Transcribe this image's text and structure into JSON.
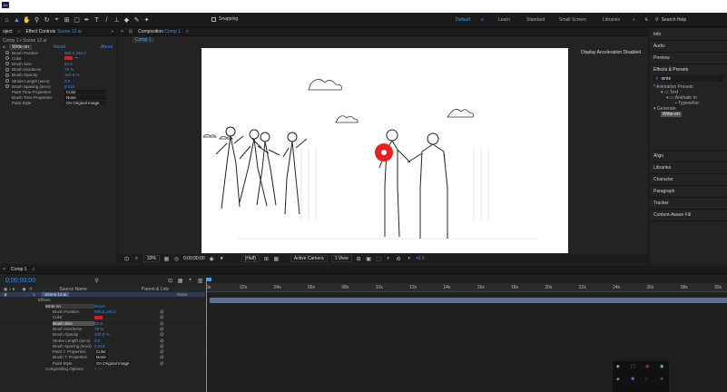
{
  "app": {
    "logo": "Ae"
  },
  "toolbar": {
    "snapping": "Snapping",
    "workspaces": [
      "Default",
      "Learn",
      "Standard",
      "Small Screen",
      "Libraries"
    ],
    "search_placeholder": "Search Help"
  },
  "project_panel": {
    "tab": "oject"
  },
  "effect_controls": {
    "tab": "Effect Controls",
    "layer": "Scene 12.ai",
    "breadcrumb": "Comp 1 • Scene 12.ai",
    "effect": "Write-on",
    "reset": "Reset",
    "about": "About",
    "props": [
      {
        "name": "Brush Position",
        "value": "985.0,340.0"
      },
      {
        "name": "Color",
        "value": ""
      },
      {
        "name": "Brush Size",
        "value": "62.5"
      },
      {
        "name": "Brush Hardness",
        "value": "79 %"
      },
      {
        "name": "Brush Opacity",
        "value": "100.0 %"
      },
      {
        "name": "Stroke Length (secs)",
        "value": "0.0"
      },
      {
        "name": "Brush Spacing (secs)",
        "value": "0.010"
      },
      {
        "name": "Paint Time Properties",
        "value": "Color"
      },
      {
        "name": "Brush Time Properties",
        "value": "None"
      },
      {
        "name": "Paint Style",
        "value": "On Original Image"
      }
    ],
    "red": "#e01b1b"
  },
  "composition": {
    "tab": "Composition",
    "comp": "Comp 1",
    "subtab": "Comp 1",
    "gpu_msg": "Display Acceleration Disabled",
    "bottom": {
      "zoom": "33%",
      "timecode": "0;00;00;00",
      "res": "(Half)",
      "camera": "Active Camera",
      "view": "1 View",
      "offset": "+0.0"
    }
  },
  "right_panel": {
    "items_top": [
      "Info",
      "Audio",
      "Preview"
    ],
    "effects_title": "Effects & Presets",
    "effects_search": "write",
    "tree": [
      "* Animation Presets",
      "Text",
      "Animate In",
      "Typewriter",
      "Generate",
      "Write-on"
    ],
    "items_bottom": [
      "Align",
      "Libraries",
      "Character",
      "Paragraph",
      "Tracker",
      "Content-Aware Fill"
    ]
  },
  "timeline": {
    "tab": "Comp 1",
    "timecode": "0;00;00;00",
    "col_source": "Source Name",
    "col_parent": "Parent & Link",
    "layer": {
      "num": "1",
      "name": "Scene 12.ai",
      "parent": "None"
    },
    "rows": [
      {
        "name": "Effects",
        "value": "",
        "indent": 1
      },
      {
        "name": "Write-on",
        "value": "Reset",
        "indent": 2
      },
      {
        "name": "Brush Position",
        "value": "985.0,340.0",
        "indent": 3
      },
      {
        "name": "Color",
        "value": "",
        "indent": 3
      },
      {
        "name": "Brush Size",
        "value": "62.5",
        "indent": 3
      },
      {
        "name": "Brush Hardness",
        "value": "79 %",
        "indent": 3
      },
      {
        "name": "Brush Opacity",
        "value": "100.0 %",
        "indent": 3
      },
      {
        "name": "Stroke Length (secs)",
        "value": "0.0",
        "indent": 3
      },
      {
        "name": "Brush Spacing (secs)",
        "value": "0.010",
        "indent": 3
      },
      {
        "name": "Paint T. Properties",
        "value": "Color",
        "indent": 3
      },
      {
        "name": "Brush T. Properties",
        "value": "None",
        "indent": 3
      },
      {
        "name": "Paint Style",
        "value": "On Original Image",
        "indent": 3
      },
      {
        "name": "Compositing Options",
        "value": "+ —",
        "indent": 2
      }
    ],
    "ruler": [
      "0s",
      "02s",
      "04s",
      "06s",
      "08s",
      "10s",
      "12s",
      "14s",
      "16s",
      "18s",
      "20s",
      "22s",
      "24s",
      "26s",
      "28s",
      "30s"
    ]
  }
}
